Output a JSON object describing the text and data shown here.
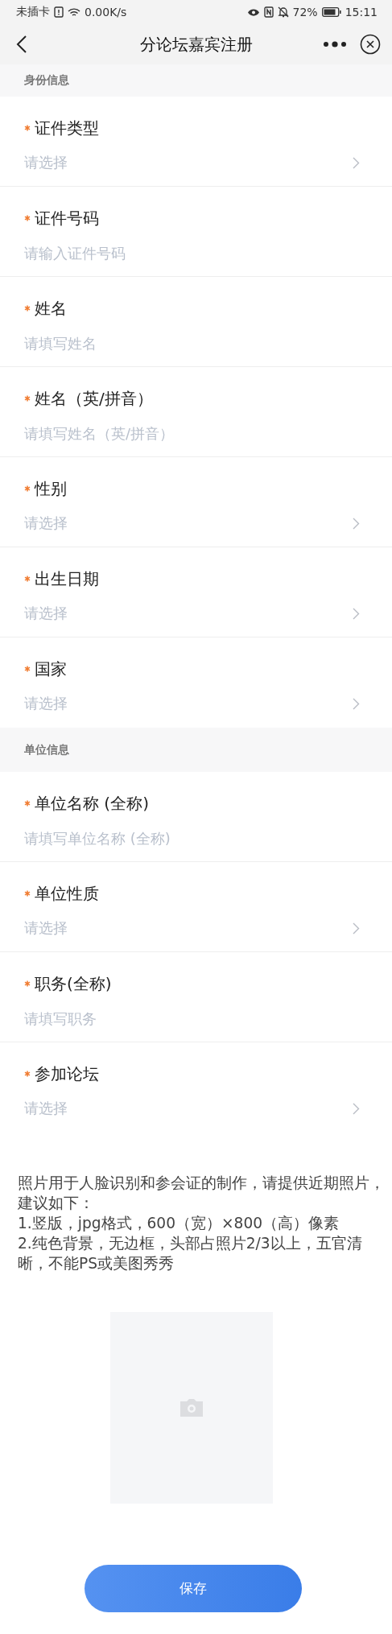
{
  "status_bar": {
    "carrier": "未插卡",
    "speed": "0.00K/s",
    "battery": "72%",
    "time": "15:11"
  },
  "nav": {
    "title": "分论坛嘉宾注册"
  },
  "sections": [
    {
      "title": "身份信息",
      "fields": [
        {
          "label": "证件类型",
          "required": true,
          "kind": "select",
          "placeholder": "请选择"
        },
        {
          "label": "证件号码",
          "required": true,
          "kind": "input",
          "placeholder": "请输入证件号码"
        },
        {
          "label": "姓名",
          "required": true,
          "kind": "input",
          "placeholder": "请填写姓名"
        },
        {
          "label": "姓名（英/拼音）",
          "required": true,
          "kind": "input",
          "placeholder": "请填写姓名（英/拼音）"
        },
        {
          "label": "性别",
          "required": true,
          "kind": "select",
          "placeholder": "请选择"
        },
        {
          "label": "出生日期",
          "required": true,
          "kind": "select",
          "placeholder": "请选择"
        },
        {
          "label": "国家",
          "required": true,
          "kind": "select",
          "placeholder": "请选择"
        }
      ]
    },
    {
      "title": "单位信息",
      "fields": [
        {
          "label": "单位名称 (全称)",
          "required": true,
          "kind": "input",
          "placeholder": "请填写单位名称 (全称)"
        },
        {
          "label": "单位性质",
          "required": true,
          "kind": "select",
          "placeholder": "请选择"
        },
        {
          "label": "职务(全称)",
          "required": true,
          "kind": "input",
          "placeholder": "请填写职务"
        },
        {
          "label": "参加论坛",
          "required": true,
          "kind": "select",
          "placeholder": "请选择"
        }
      ]
    }
  ],
  "photo": {
    "instructions": [
      "照片用于人脸识别和参会证的制作，请提供近期照片，建议如下：",
      "1.竖版，jpg格式，600（宽）×800（高）像素",
      "2.纯色背景，无边框，头部占照片2/3以上，五官清晰，不能PS或美图秀秀"
    ]
  },
  "save_button": "保存"
}
